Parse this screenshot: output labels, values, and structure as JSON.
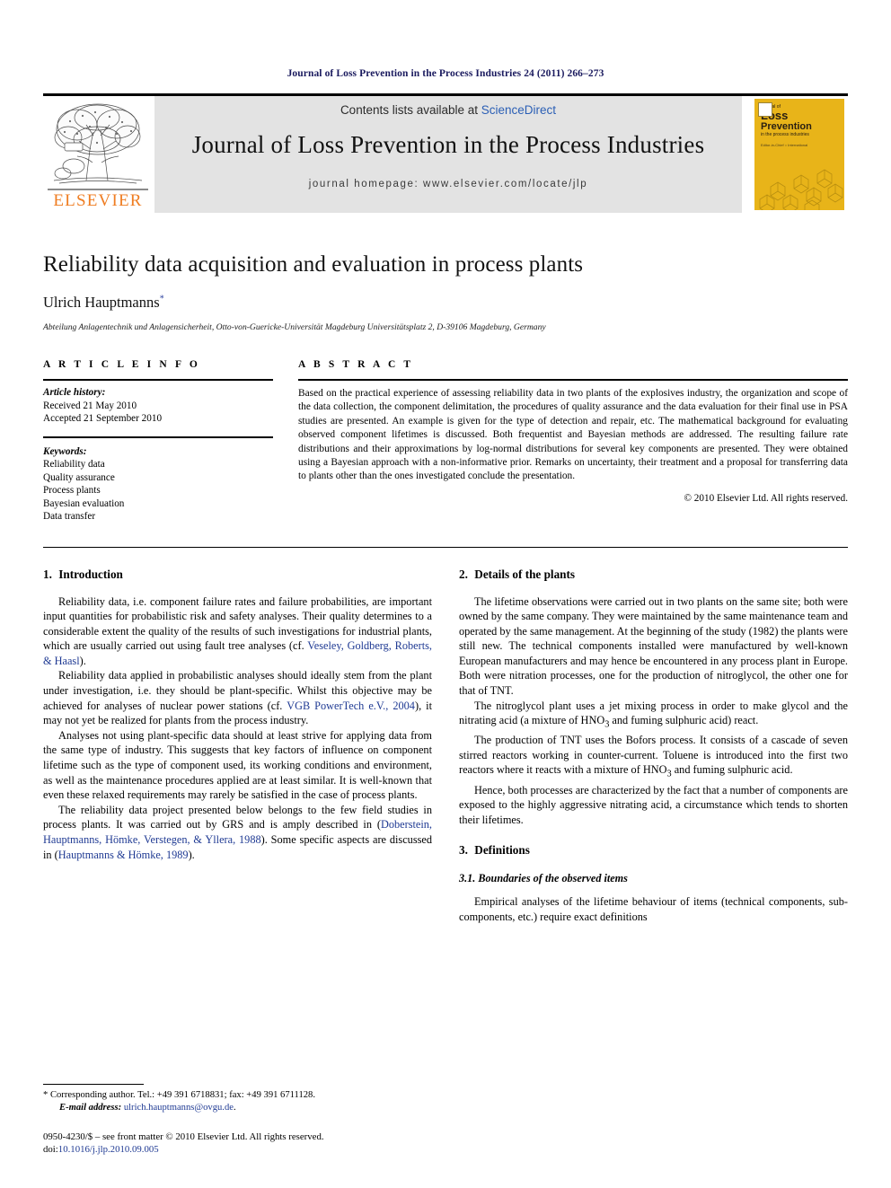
{
  "running_head": "Journal of Loss Prevention in the Process Industries 24 (2011) 266–273",
  "masthead": {
    "publisher_wordmark": "ELSEVIER",
    "contents_prefix": "Contents lists available at ",
    "contents_link": "ScienceDirect",
    "journal_title": "Journal of Loss Prevention in the Process Industries",
    "homepage_line": "journal homepage: www.elsevier.com/locate/jlp",
    "cover": {
      "line1": "Journal of",
      "line2": "Loss",
      "line3": "Prevention",
      "line4": "in the process industries",
      "line5": "Editor-in-Chief  ○ International"
    },
    "accent_orange": "#ef7d22",
    "link_blue": "#2b5fb5",
    "cover_yellow": "#e8b419"
  },
  "title_block": {
    "title": "Reliability data acquisition and evaluation in process plants",
    "author": "Ulrich Hauptmanns",
    "author_marker": "*",
    "affiliation": "Abteilung Anlagentechnik und Anlagensicherheit, Otto-von-Guericke-Universität Magdeburg Universitätsplatz 2, D-39106 Magdeburg, Germany"
  },
  "article_info": {
    "heading": "A R T I C L E   I N F O",
    "history_label": "Article history:",
    "received": "Received 21 May 2010",
    "accepted": "Accepted 21 September 2010",
    "keywords_label": "Keywords:",
    "keywords": [
      "Reliability data",
      "Quality assurance",
      "Process plants",
      "Bayesian evaluation",
      "Data transfer"
    ]
  },
  "abstract": {
    "heading": "A B S T R A C T",
    "text": "Based on the practical experience of assessing reliability data in two plants of the explosives industry, the organization and scope of the data collection, the component delimitation, the procedures of quality assurance and the data evaluation for their final use in PSA studies are presented. An example is given for the type of detection and repair, etc. The mathematical background for evaluating observed component lifetimes is discussed. Both frequentist and Bayesian methods are addressed. The resulting failure rate distributions and their approximations by log-normal distributions for several key components are presented. They were obtained using a Bayesian approach with a non-informative prior. Remarks on uncertainty, their treatment and a proposal for transferring data to plants other than the ones investigated conclude the presentation.",
    "copyright": "© 2010 Elsevier Ltd. All rights reserved."
  },
  "sections": {
    "introduction": {
      "number": "1.",
      "title": "Introduction",
      "p1_a": "Reliability data, i.e. component failure rates and failure probabilities, are important input quantities for probabilistic risk and safety analyses. Their quality determines to a considerable extent the quality of the results of such investigations for industrial plants, which are usually carried out using fault tree analyses (cf. ",
      "p1_cite": "Veseley, Goldberg, Roberts, & Haasl",
      "p1_b": ").",
      "p2_a": "Reliability data applied in probabilistic analyses should ideally stem from the plant under investigation, i.e. they should be plant-specific. Whilst this objective may be achieved for analyses of nuclear power stations (cf. ",
      "p2_cite": "VGB PowerTech e.V., 2004",
      "p2_b": "), it may not yet be realized for plants from the process industry.",
      "p3": "Analyses not using plant-specific data should at least strive for applying data from the same type of industry. This suggests that key factors of influence on component lifetime such as the type of component used, its working conditions and environment, as well as the maintenance procedures applied are at least similar. It is well-known that even these relaxed requirements may rarely be satisfied in the case of process plants.",
      "p4_a": "The reliability data project presented below belongs to the few field studies in process plants. It was carried out by GRS and is amply described in (",
      "p4_cite1": "Doberstein, Hauptmanns, Hömke, Verstegen, & Yllera, 1988",
      "p4_b": "). Some specific aspects are discussed in (",
      "p4_cite2": "Hauptmanns & Hömke, 1989",
      "p4_c": ")."
    },
    "details_of_plants": {
      "number": "2.",
      "title": "Details of the plants",
      "p1": "The lifetime observations were carried out in two plants on the same site; both were owned by the same company. They were maintained by the same maintenance team and operated by the same management. At the beginning of the study (1982) the plants were still new. The technical components installed were manufactured by well-known European manufacturers and may hence be encountered in any process plant in Europe. Both were nitration processes, one for the production of nitroglycol, the other one for that of TNT.",
      "p2_a": "The nitroglycol plant uses a jet mixing process in order to make glycol and the nitrating acid (a mixture of HNO",
      "p2_sub": "3",
      "p2_b": " and fuming sulphuric acid) react.",
      "p3": "The production of TNT uses the Bofors process. It consists of a cascade of seven stirred reactors working in counter-current. Toluene is introduced into the first two reactors where it reacts with a mixture of HNO",
      "p3_sub": "3",
      "p3_b": " and fuming sulphuric acid.",
      "p4": "Hence, both processes are characterized by the fact that a number of components are exposed to the highly aggressive nitrating acid, a circumstance which tends to shorten their lifetimes."
    },
    "definitions": {
      "number": "3.",
      "title": "Definitions",
      "sub_number": "3.1.",
      "sub_title": "Boundaries of the observed items",
      "p1": "Empirical analyses of the lifetime behaviour of items (technical components, sub-components, etc.) require exact definitions"
    }
  },
  "footnotes": {
    "corresponding": "* Corresponding author. Tel.: +49 391 6718831; fax: +49 391 6711128.",
    "email_label": "E-mail address:",
    "email": "ulrich.hauptmanns@ovgu.de",
    "email_suffix": ".",
    "issn_line": "0950-4230/$ – see front matter © 2010 Elsevier Ltd. All rights reserved.",
    "doi_label": "doi:",
    "doi": "10.1016/j.jlp.2010.09.005"
  }
}
